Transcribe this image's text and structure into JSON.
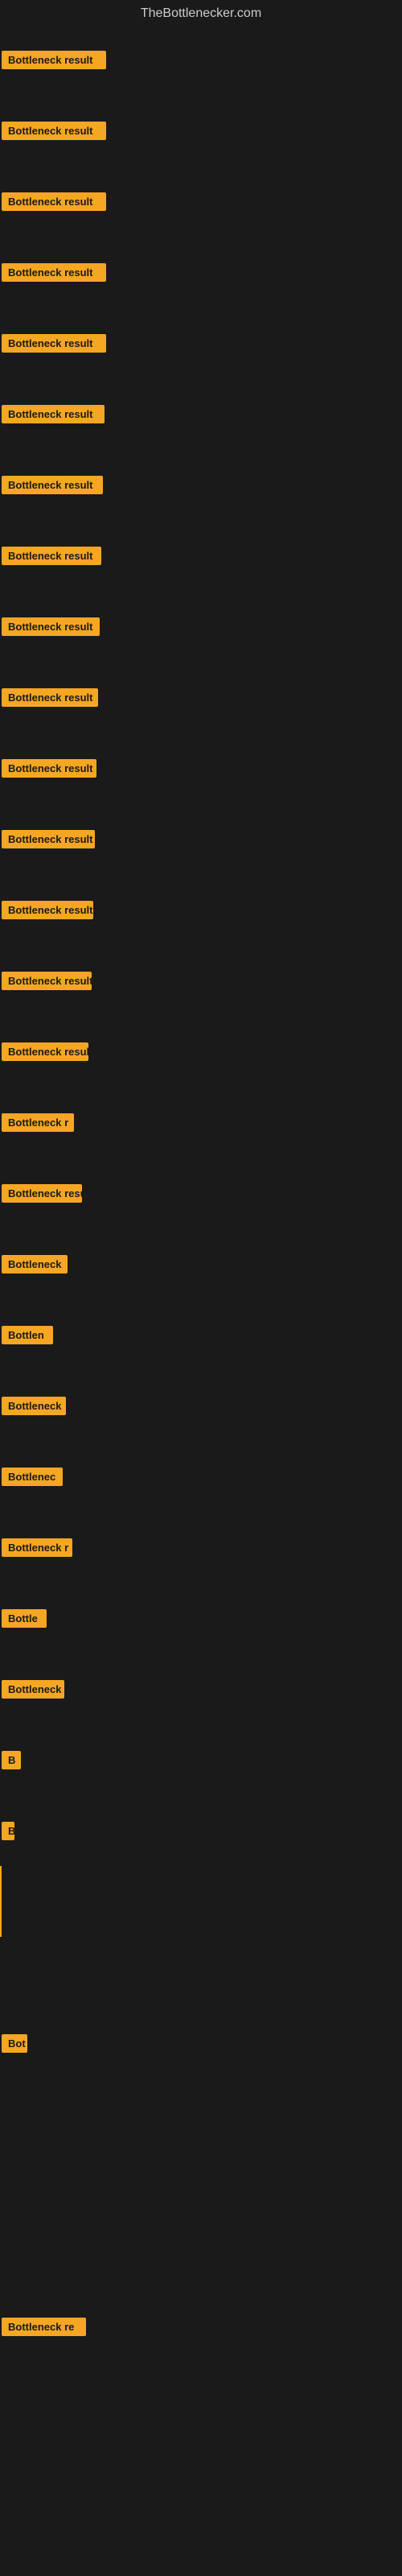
{
  "site_title": "TheBottlenecker.com",
  "rows": [
    {
      "id": 1,
      "label": "Bottleneck result",
      "width": 130,
      "has_line": false
    },
    {
      "id": 2,
      "label": "Bottleneck result",
      "width": 130,
      "has_line": false
    },
    {
      "id": 3,
      "label": "Bottleneck result",
      "width": 130,
      "has_line": false
    },
    {
      "id": 4,
      "label": "Bottleneck result",
      "width": 130,
      "has_line": false
    },
    {
      "id": 5,
      "label": "Bottleneck result",
      "width": 130,
      "has_line": false
    },
    {
      "id": 6,
      "label": "Bottleneck result",
      "width": 128,
      "has_line": false
    },
    {
      "id": 7,
      "label": "Bottleneck result",
      "width": 126,
      "has_line": false
    },
    {
      "id": 8,
      "label": "Bottleneck result",
      "width": 124,
      "has_line": false
    },
    {
      "id": 9,
      "label": "Bottleneck result",
      "width": 122,
      "has_line": false
    },
    {
      "id": 10,
      "label": "Bottleneck result",
      "width": 120,
      "has_line": false
    },
    {
      "id": 11,
      "label": "Bottleneck result",
      "width": 118,
      "has_line": false
    },
    {
      "id": 12,
      "label": "Bottleneck result",
      "width": 116,
      "has_line": false
    },
    {
      "id": 13,
      "label": "Bottleneck result",
      "width": 114,
      "has_line": false
    },
    {
      "id": 14,
      "label": "Bottleneck result",
      "width": 112,
      "has_line": false
    },
    {
      "id": 15,
      "label": "Bottleneck result",
      "width": 108,
      "has_line": false
    },
    {
      "id": 16,
      "label": "Bottleneck r",
      "width": 90,
      "has_line": false
    },
    {
      "id": 17,
      "label": "Bottleneck resu",
      "width": 100,
      "has_line": false
    },
    {
      "id": 18,
      "label": "Bottleneck",
      "width": 82,
      "has_line": false
    },
    {
      "id": 19,
      "label": "Bottlen",
      "width": 64,
      "has_line": false
    },
    {
      "id": 20,
      "label": "Bottleneck",
      "width": 80,
      "has_line": false
    },
    {
      "id": 21,
      "label": "Bottlenec",
      "width": 76,
      "has_line": false
    },
    {
      "id": 22,
      "label": "Bottleneck r",
      "width": 88,
      "has_line": false
    },
    {
      "id": 23,
      "label": "Bottle",
      "width": 56,
      "has_line": false
    },
    {
      "id": 24,
      "label": "Bottleneck",
      "width": 78,
      "has_line": false
    },
    {
      "id": 25,
      "label": "B",
      "width": 24,
      "has_line": false
    },
    {
      "id": 26,
      "label": "B",
      "width": 14,
      "has_line": false
    },
    {
      "id": 27,
      "label": "",
      "width": 0,
      "has_line": true
    },
    {
      "id": 28,
      "label": "",
      "width": 0,
      "has_line": false
    },
    {
      "id": 29,
      "label": "Bot",
      "width": 32,
      "has_line": false
    },
    {
      "id": 30,
      "label": "",
      "width": 0,
      "has_line": false
    },
    {
      "id": 31,
      "label": "",
      "width": 0,
      "has_line": false
    },
    {
      "id": 32,
      "label": "",
      "width": 0,
      "has_line": false
    },
    {
      "id": 33,
      "label": "Bottleneck re",
      "width": 105,
      "has_line": false
    },
    {
      "id": 34,
      "label": "",
      "width": 0,
      "has_line": false
    },
    {
      "id": 35,
      "label": "",
      "width": 0,
      "has_line": false
    },
    {
      "id": 36,
      "label": "",
      "width": 0,
      "has_line": false
    }
  ]
}
